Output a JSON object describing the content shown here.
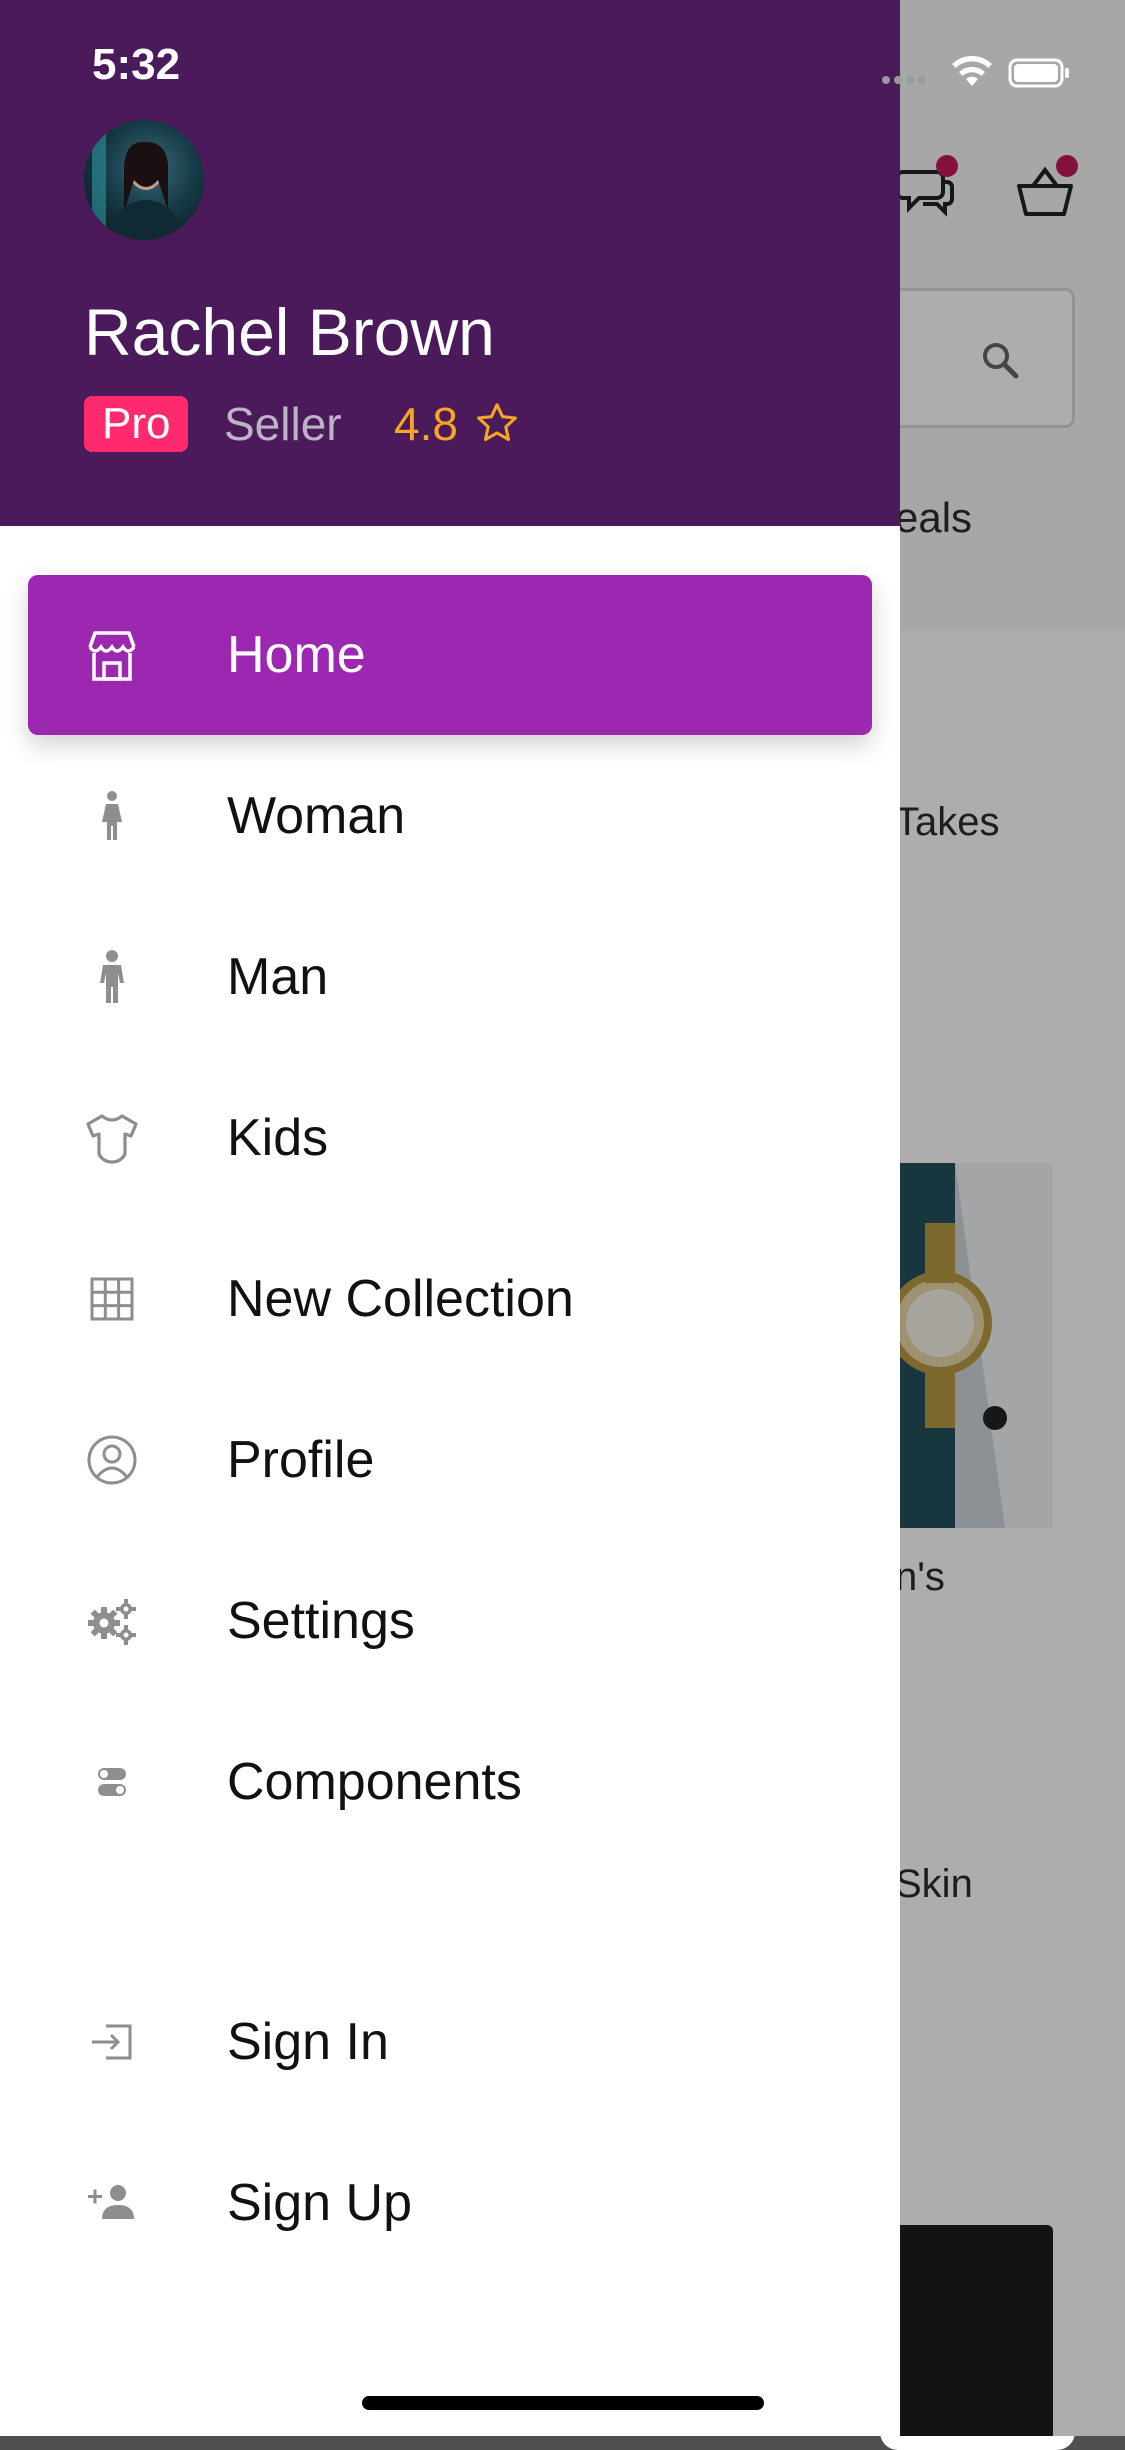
{
  "status_bar": {
    "time": "5:32"
  },
  "user": {
    "name": "Rachel Brown",
    "badge": "Pro",
    "role": "Seller",
    "rating": "4.8"
  },
  "menu": {
    "items": [
      {
        "label": "Home",
        "icon": "store-icon",
        "active": true
      },
      {
        "label": "Woman",
        "icon": "woman-icon"
      },
      {
        "label": "Man",
        "icon": "man-icon"
      },
      {
        "label": "Kids",
        "icon": "baby-bodysuit-icon"
      },
      {
        "label": "New Collection",
        "icon": "grid-icon"
      },
      {
        "label": "Profile",
        "icon": "user-circle-icon"
      },
      {
        "label": "Settings",
        "icon": "gears-icon"
      },
      {
        "label": "Components",
        "icon": "toggles-icon"
      }
    ],
    "auth_items": [
      {
        "label": "Sign In",
        "icon": "sign-in-icon"
      },
      {
        "label": "Sign Up",
        "icon": "add-user-icon"
      }
    ]
  },
  "background": {
    "tab_fragment": "eals",
    "card1_fragment": "Takes",
    "card2_fragment": "n's",
    "card3_fragment": "Skin"
  },
  "colors": {
    "header_bg": "#4a1a5a",
    "active_item_bg": "#9c27b0",
    "pro_badge": "#ff2a6d",
    "rating": "#f5a623"
  }
}
